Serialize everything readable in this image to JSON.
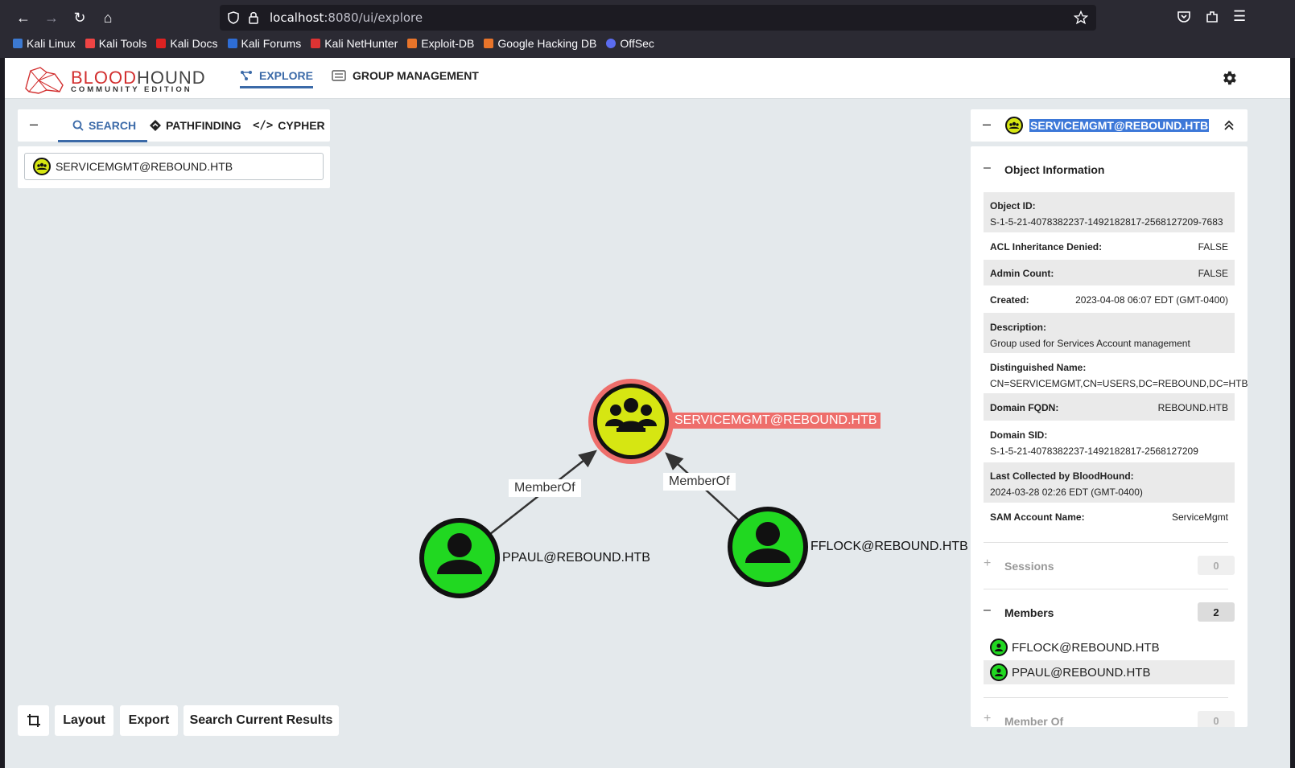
{
  "browser": {
    "url_host": "localhost",
    "url_path": ":8080/ui/explore",
    "bookmarks": [
      "Kali Linux",
      "Kali Tools",
      "Kali Docs",
      "Kali Forums",
      "Kali NetHunter",
      "Exploit-DB",
      "Google Hacking DB",
      "OffSec"
    ]
  },
  "app": {
    "logo_brand_a": "BLOOD",
    "logo_brand_b": "HOUND",
    "logo_sub": "COMMUNITY EDITION",
    "tabs": {
      "explore": "EXPLORE",
      "group_management": "GROUP MANAGEMENT"
    }
  },
  "search_panel": {
    "tabs": {
      "search": "SEARCH",
      "pathfinding": "PATHFINDING",
      "cypher": "CYPHER"
    },
    "query": "SERVICEMGMT@REBOUND.HTB"
  },
  "graph": {
    "nodes": {
      "group": "SERVICEMGMT@REBOUND.HTB",
      "user1": "PPAUL@REBOUND.HTB",
      "user2": "FFLOCK@REBOUND.HTB"
    },
    "edges": {
      "e1": "MemberOf",
      "e2": "MemberOf"
    }
  },
  "buttons": {
    "layout": "Layout",
    "export": "Export",
    "search_results": "Search Current Results"
  },
  "entity": {
    "title": "SERVICEMGMT@REBOUND.HTB",
    "object_info_title": "Object Information",
    "props": {
      "object_id_k": "Object ID:",
      "object_id_v": "S-1-5-21-4078382237-1492182817-2568127209-7683",
      "acl_k": "ACL Inheritance Denied:",
      "acl_v": "FALSE",
      "admin_k": "Admin Count:",
      "admin_v": "FALSE",
      "created_k": "Created:",
      "created_v": "2023-04-08 06:07 EDT (GMT-0400)",
      "desc_k": "Description:",
      "desc_v": "Group used for Services Account management",
      "dn_k": "Distinguished Name:",
      "dn_v": "CN=SERVICEMGMT,CN=USERS,DC=REBOUND,DC=HTB",
      "fqdn_k": "Domain FQDN:",
      "fqdn_v": "REBOUND.HTB",
      "sid_k": "Domain SID:",
      "sid_v": "S-1-5-21-4078382237-1492182817-2568127209",
      "last_k": "Last Collected by BloodHound:",
      "last_v": "2024-03-28 02:26 EDT (GMT-0400)",
      "sam_k": "SAM Account Name:",
      "sam_v": "ServiceMgmt"
    },
    "sessions": {
      "label": "Sessions",
      "count": "0"
    },
    "members": {
      "label": "Members",
      "count": "2",
      "items": [
        "FFLOCK@REBOUND.HTB",
        "PPAUL@REBOUND.HTB"
      ]
    },
    "member_of": {
      "label": "Member Of",
      "count": "0"
    }
  }
}
